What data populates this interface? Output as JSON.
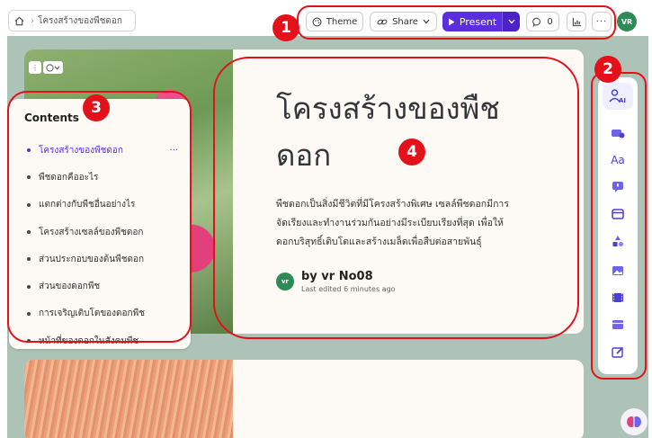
{
  "breadcrumb": {
    "page": "โครงสร้างของพืชดอก"
  },
  "toolbar": {
    "theme_label": "Theme",
    "share_label": "Share",
    "present_label": "Present",
    "comment_count": "0",
    "avatar_initials": "VR"
  },
  "card": {
    "title_line1": "โครงสร้างของพืช",
    "title_line2": "ดอก",
    "description_line1": "พืชดอกเป็นสิ่งมีชีวิตที่มีโครงสร้างพิเศษ เซลล์พืชดอกมีการ",
    "description_line2": "จัดเรียงและทำงานร่วมกันอย่างมีระเบียบเรียงที่สุด เพื่อให้",
    "description_line3": "ดอกบริสุทธิ์เติบโตและสร้างเมล็ดเพื่อสืบต่อสายพันธุ์",
    "author_initials": "vr",
    "author": "by vr No08",
    "edited": "Last edited 6 minutes ago"
  },
  "contents": {
    "heading": "Contents",
    "items": [
      {
        "label": "โครงสร้างของพืชดอก"
      },
      {
        "label": "พืชดอกคืออะไร"
      },
      {
        "label": "แตกต่างกับพืชอื่นอย่างไร"
      },
      {
        "label": "โครงสร้างเซลล์ของพืชดอก"
      },
      {
        "label": "ส่วนประกอบของต้นพืชดอก"
      },
      {
        "label": "ส่วนของดอกพืช"
      },
      {
        "label": "การเจริญเติบโตของดอกพืช"
      },
      {
        "label": "หน้าที่ของดอกในสังคมพืช"
      }
    ],
    "more_label": "···"
  },
  "annotations": [
    "1",
    "2",
    "3",
    "4"
  ],
  "colors": {
    "accent": "#5b2ee0",
    "annotation": "#e2111a",
    "avatar": "#2e8b57",
    "canvas": "#adc3b8"
  }
}
